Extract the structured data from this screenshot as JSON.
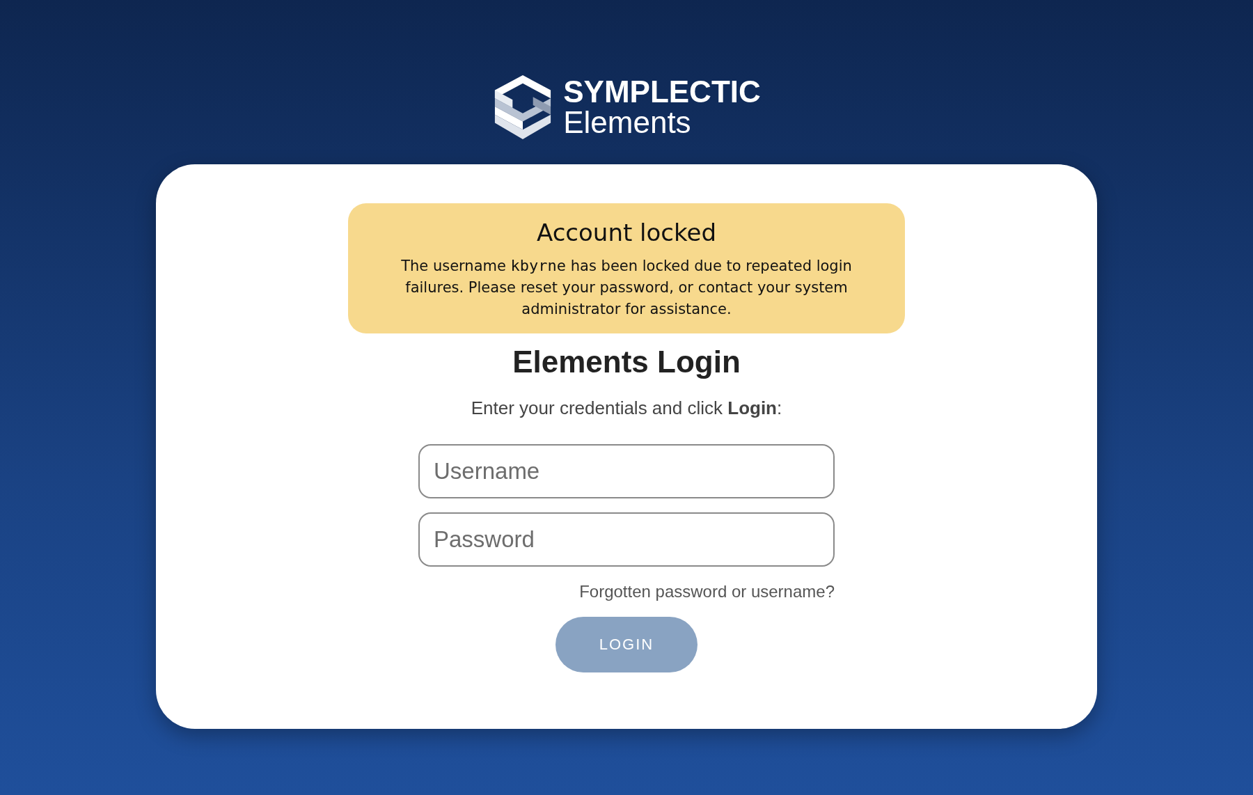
{
  "logo": {
    "title": "SYMPLECTIC",
    "subtitle": "Elements"
  },
  "alert": {
    "title": "Account locked",
    "message": {
      "before": "The username ",
      "username": "kbyrne",
      "after": " has been locked due to repeated login failures. Please reset your password, or contact your system administrator for assistance."
    }
  },
  "login": {
    "heading": "Elements Login",
    "instructions": "Enter your credentials and click **Login**:",
    "username": {
      "placeholder": "Username"
    },
    "password": {
      "placeholder": "Password"
    },
    "forgot_link": "Forgotten password or username?",
    "button": {
      "label": "LOGIN",
      "disabled": true
    }
  }
}
